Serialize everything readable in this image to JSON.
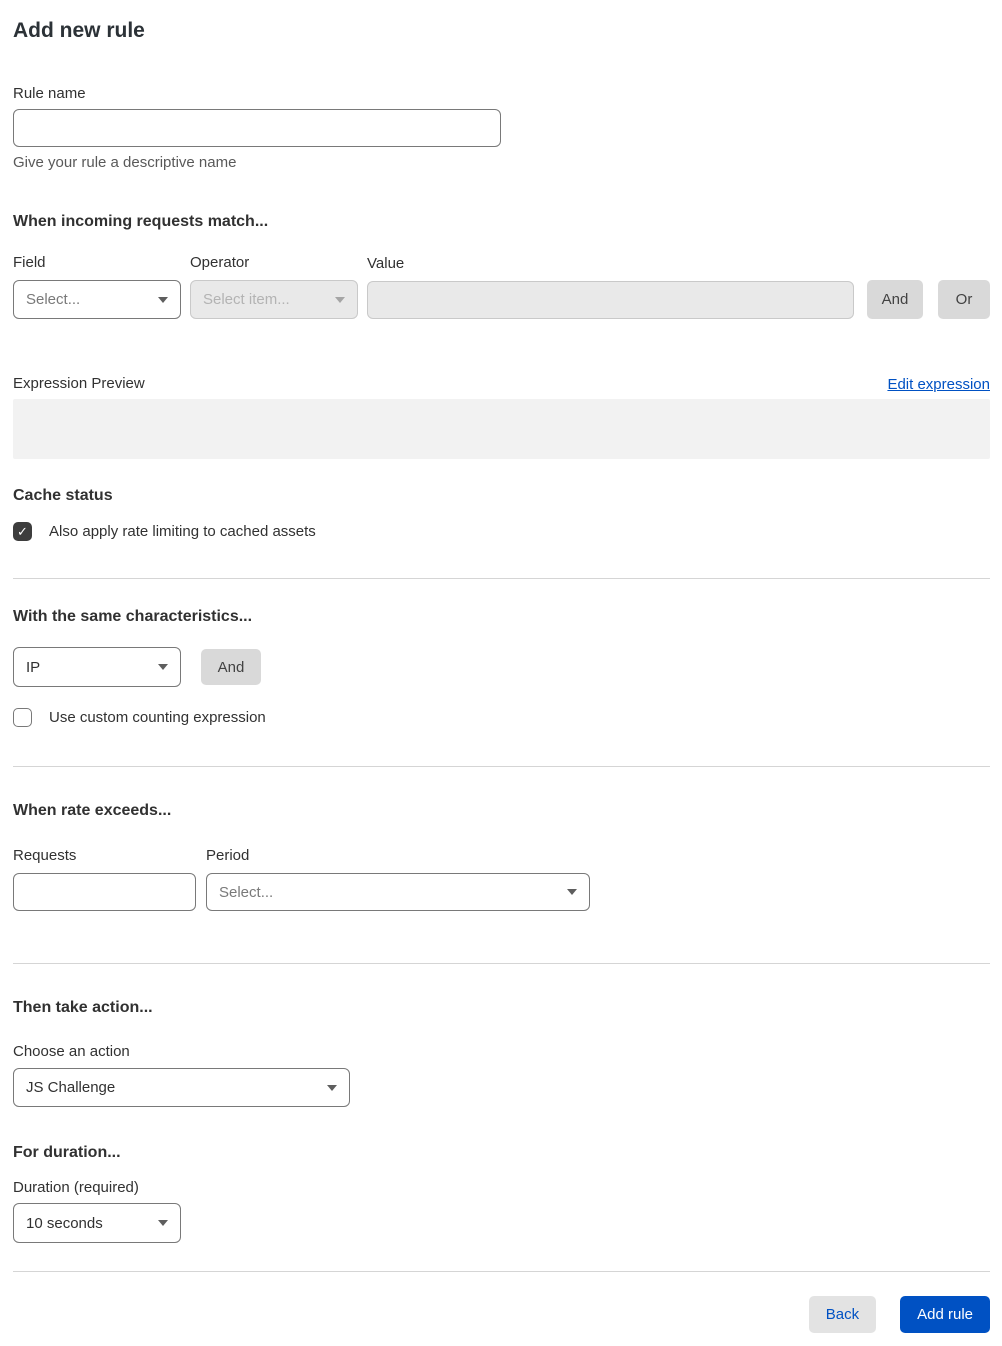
{
  "page": {
    "title": "Add new rule"
  },
  "rule_name": {
    "label": "Rule name",
    "value": "",
    "help": "Give your rule a descriptive name"
  },
  "match": {
    "heading": "When incoming requests match...",
    "field": {
      "label": "Field",
      "selected": "Select..."
    },
    "operator": {
      "label": "Operator",
      "selected": "Select item...",
      "disabled": true
    },
    "value": {
      "label": "Value",
      "value": "",
      "disabled": true
    },
    "and_label": "And",
    "or_label": "Or"
  },
  "expression": {
    "preview_label": "Expression Preview",
    "edit_link_label": "Edit expression",
    "preview_value": ""
  },
  "cache_status": {
    "heading": "Cache status",
    "checkbox_label": "Also apply rate limiting to cached assets",
    "checked": true
  },
  "characteristics": {
    "heading": "With the same characteristics...",
    "select_selected": "IP",
    "and_label": "And",
    "checkbox_label": "Use custom counting expression",
    "checked": false
  },
  "rate": {
    "heading": "When rate exceeds...",
    "requests": {
      "label": "Requests",
      "value": ""
    },
    "period": {
      "label": "Period",
      "selected": "Select..."
    }
  },
  "action": {
    "heading": "Then take action...",
    "label": "Choose an action",
    "selected": "JS Challenge"
  },
  "duration": {
    "heading": "For duration...",
    "label": "Duration (required)",
    "selected": "10 seconds"
  },
  "footer": {
    "back_label": "Back",
    "add_rule_label": "Add rule"
  },
  "icons": {
    "chevron_down": "chevron-down-icon",
    "check": "check-icon",
    "check_glyph": "✓"
  },
  "colors": {
    "accent_blue": "#0051c3",
    "heading_text": "#313131",
    "checkbox_checked_bg": "#3d3d3d",
    "disabled_bg": "#e9e9e9",
    "gray_button_bg": "#d9d9d9",
    "preview_box_bg": "#f2f2f2",
    "divider": "#d5d5d5"
  }
}
